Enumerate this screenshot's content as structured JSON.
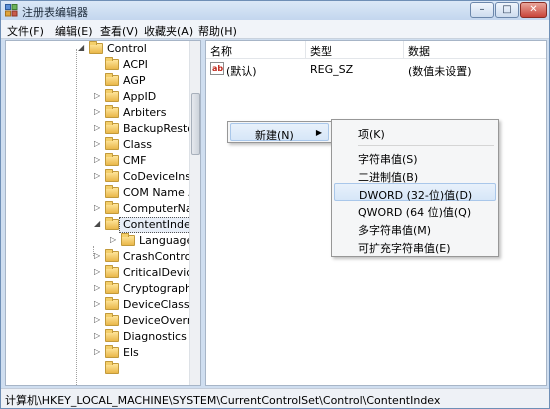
{
  "window": {
    "title": "注册表编辑器",
    "min_label": "–",
    "max_label": "□",
    "close_label": "✕"
  },
  "menubar": [
    {
      "label": "文件(F)"
    },
    {
      "label": "编辑(E)"
    },
    {
      "label": "查看(V)"
    },
    {
      "label": "收藏夹(A)"
    },
    {
      "label": "帮助(H)"
    }
  ],
  "tree": {
    "items": [
      {
        "label": "Control",
        "expander": "◢"
      },
      {
        "label": "ACPI",
        "expander": ""
      },
      {
        "label": "AGP",
        "expander": ""
      },
      {
        "label": "AppID",
        "expander": "▷"
      },
      {
        "label": "Arbiters",
        "expander": "▷"
      },
      {
        "label": "BackupRestor",
        "expander": "▷"
      },
      {
        "label": "Class",
        "expander": "▷"
      },
      {
        "label": "CMF",
        "expander": "▷"
      },
      {
        "label": "CoDeviceInsta",
        "expander": "▷"
      },
      {
        "label": "COM Name A",
        "expander": ""
      },
      {
        "label": "ComputerNar",
        "expander": "▷"
      },
      {
        "label": "ContentIndex",
        "expander": "◢"
      },
      {
        "label": "Language",
        "expander": "▷"
      },
      {
        "label": "CrashControl",
        "expander": "▷"
      },
      {
        "label": "CriticalDeviceI",
        "expander": "▷"
      },
      {
        "label": "Cryptography",
        "expander": "▷"
      },
      {
        "label": "DeviceClasses",
        "expander": "▷"
      },
      {
        "label": "DeviceOverrid",
        "expander": "▷"
      },
      {
        "label": "Diagnostics",
        "expander": "▷"
      },
      {
        "label": "Els",
        "expander": "▷"
      }
    ]
  },
  "list": {
    "columns": {
      "name": "名称",
      "type": "类型",
      "data": "数据"
    },
    "rows": [
      {
        "icon": "ab",
        "name": "(默认)",
        "type": "REG_SZ",
        "data": "(数值未设置)"
      }
    ]
  },
  "context_menu": {
    "new_label": "新建(N)",
    "submenu_arrow": "▶"
  },
  "submenu": {
    "items": [
      {
        "label": "项(K)"
      },
      {
        "label": "字符串值(S)"
      },
      {
        "label": "二进制值(B)"
      },
      {
        "label": "DWORD (32-位)值(D)"
      },
      {
        "label": "QWORD (64 位)值(Q)"
      },
      {
        "label": "多字符串值(M)"
      },
      {
        "label": "可扩充字符串值(E)"
      }
    ]
  },
  "statusbar": {
    "path": "计算机\\HKEY_LOCAL_MACHINE\\SYSTEM\\CurrentControlSet\\Control\\ContentIndex"
  }
}
